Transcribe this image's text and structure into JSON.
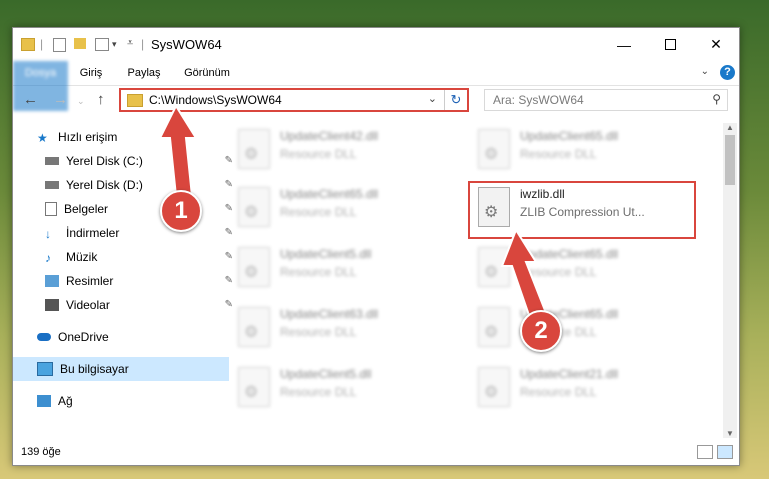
{
  "window": {
    "title": "SysWOW64",
    "minimize_icon": "minimize-icon",
    "maximize_icon": "maximize-icon",
    "close_icon": "close-icon"
  },
  "ribbon": {
    "tabs": [
      "Dosya",
      "Giriş",
      "Paylaş",
      "Görünüm"
    ],
    "help": "?"
  },
  "address": {
    "path": "C:\\Windows\\SysWOW64",
    "search_placeholder": "Ara: SysWOW64"
  },
  "nav": {
    "items": [
      {
        "label": "Hızlı erişim",
        "icon": "star-icon"
      },
      {
        "label": "Yerel Disk (C:)",
        "icon": "drive-icon"
      },
      {
        "label": "Yerel Disk (D:)",
        "icon": "drive-icon"
      },
      {
        "label": "Belgeler",
        "icon": "documents-icon"
      },
      {
        "label": "İndirmeler",
        "icon": "download-icon"
      },
      {
        "label": "Müzik",
        "icon": "music-icon"
      },
      {
        "label": "Resimler",
        "icon": "pictures-icon"
      },
      {
        "label": "Videolar",
        "icon": "videos-icon"
      },
      {
        "label": "OneDrive",
        "icon": "cloud-icon"
      },
      {
        "label": "Bu bilgisayar",
        "icon": "computer-icon"
      },
      {
        "label": "Ağ",
        "icon": "network-icon"
      }
    ]
  },
  "files": [
    {
      "name": "UpdateClient42.dll",
      "desc": "Resource DLL"
    },
    {
      "name": "UpdateClient65.dll",
      "desc": "Resource DLL"
    },
    {
      "name": "UpdateClient65.dll",
      "desc": "Resource DLL"
    },
    {
      "name": "iwzlib.dll",
      "desc": "ZLIB Compression Ut..."
    },
    {
      "name": "UpdateClient5.dll",
      "desc": "Resource DLL"
    },
    {
      "name": "UpdateClient65.dll",
      "desc": "Resource DLL"
    },
    {
      "name": "UpdateClient63.dll",
      "desc": "Resource DLL"
    },
    {
      "name": "UpdateClient65.dll",
      "desc": "Resource DLL"
    },
    {
      "name": "UpdateClient5.dll",
      "desc": "Resource DLL"
    },
    {
      "name": "UpdateClient21.dll",
      "desc": "Resource DLL"
    }
  ],
  "status": {
    "count": "139 öğe"
  },
  "steps": [
    "1",
    "2"
  ],
  "colors": {
    "accent": "#1979ca",
    "highlight": "#d9463d"
  }
}
